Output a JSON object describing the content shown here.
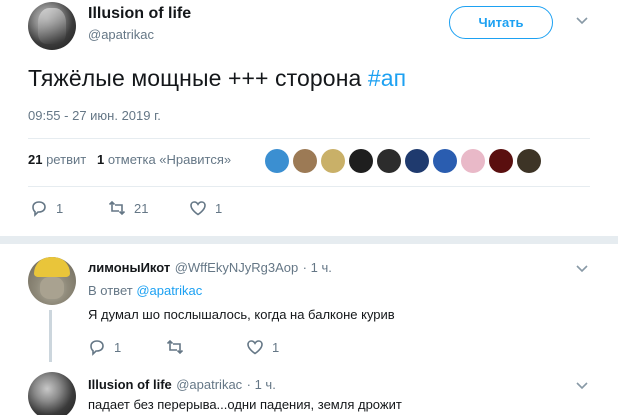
{
  "main_tweet": {
    "author_name": "Illusion of life",
    "author_handle": "@apatrikac",
    "follow_label": "Читать",
    "text": "Тяжёлые мощные +++ сторона ",
    "hashtag": "#ап",
    "timestamp": "09:55 - 27 июн. 2019 г.",
    "retweet_count": "21",
    "retweet_label": " ретвит",
    "like_count": "1",
    "like_label": " отметка «Нравится»",
    "actions": {
      "replies": "1",
      "retweets": "21",
      "likes": "1"
    }
  },
  "replies": [
    {
      "author_name": "лимоныИкот",
      "author_handle": "@WffEkyNJyRg3Aop",
      "time": "· 1 ч.",
      "in_reply_prefix": "В ответ ",
      "in_reply_handle": "@apatrikac",
      "text": "Я думал шо послышалось, когда на балконе курив",
      "actions": {
        "replies": "1",
        "retweets": "",
        "likes": "1"
      }
    },
    {
      "author_name": "Illusion of life",
      "author_handle": "@apatrikac",
      "time": "· 1 ч.",
      "text": "падает без перерыва...одни падения, земля дрожит"
    }
  ],
  "liker_avatar_colors": [
    "#3b8fd1",
    "#9c7a55",
    "#c9b068",
    "#1e1e1e",
    "#2c2c2c",
    "#1f3a6e",
    "#2a5db0",
    "#e9b9c8",
    "#5a0f0f",
    "#3d3426"
  ]
}
